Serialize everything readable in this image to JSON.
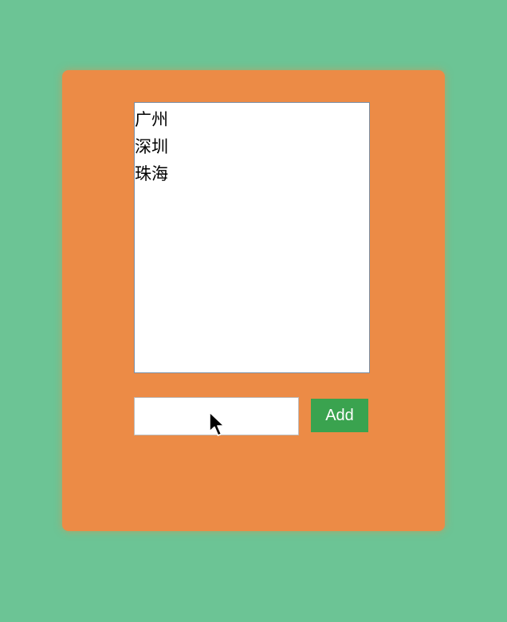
{
  "city_list": {
    "items": [
      "广州",
      "深圳",
      "珠海"
    ]
  },
  "add_form": {
    "input_value": "",
    "input_placeholder": "",
    "add_label": "Add"
  },
  "colors": {
    "background": "#6cc495",
    "panel": "#ec8b46",
    "add_button": "#3aa34f"
  },
  "icons": {
    "cursor": "mouse-pointer-icon"
  }
}
